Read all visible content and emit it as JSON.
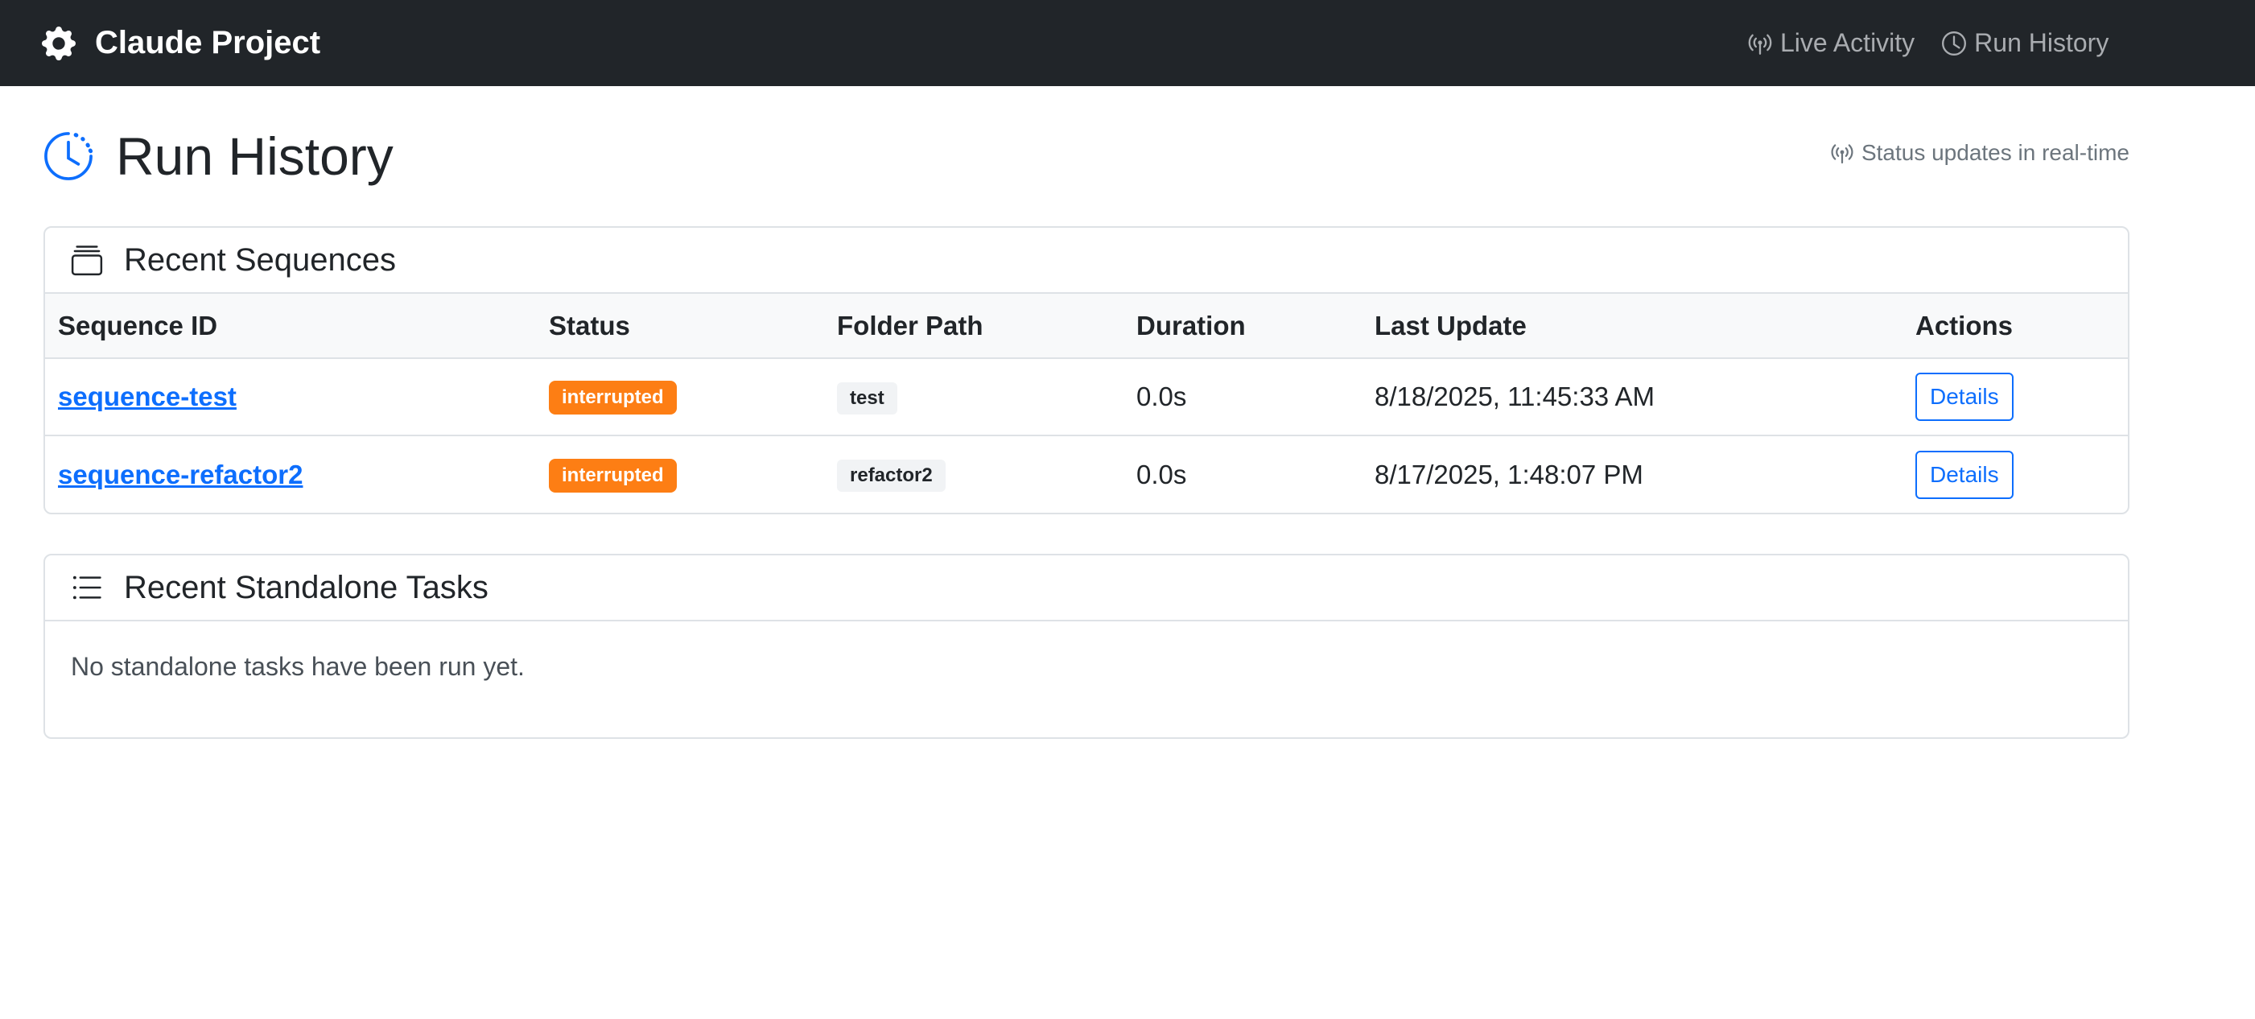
{
  "navbar": {
    "brand": "Claude Project",
    "links": [
      {
        "label": "Live Activity",
        "icon": "broadcast-icon"
      },
      {
        "label": "Run History",
        "icon": "clock-icon"
      }
    ]
  },
  "header": {
    "title": "Run History",
    "status_note": "Status updates in real-time"
  },
  "sequences": {
    "title": "Recent Sequences",
    "columns": [
      "Sequence ID",
      "Status",
      "Folder Path",
      "Duration",
      "Last Update",
      "Actions"
    ],
    "rows": [
      {
        "id": "sequence-test",
        "status": "interrupted",
        "folder": "test",
        "duration": "0.0s",
        "updated": "8/18/2025, 11:45:33 AM",
        "action": "Details"
      },
      {
        "id": "sequence-refactor2",
        "status": "interrupted",
        "folder": "refactor2",
        "duration": "0.0s",
        "updated": "8/17/2025, 1:48:07 PM",
        "action": "Details"
      }
    ]
  },
  "tasks": {
    "title": "Recent Standalone Tasks",
    "empty_message": "No standalone tasks have been run yet."
  },
  "colors": {
    "navbar_bg": "#212529",
    "accent": "#0d6efd",
    "status_interrupted": "#fd7e14"
  }
}
